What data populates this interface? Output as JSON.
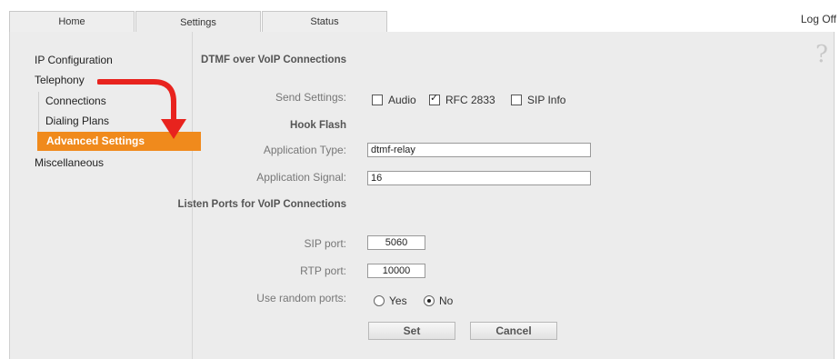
{
  "tabs": [
    {
      "label": "Home"
    },
    {
      "label": "Settings"
    },
    {
      "label": "Status"
    }
  ],
  "header": {
    "logoff": "Log Off",
    "help_icon": "?"
  },
  "sidebar": {
    "items": [
      {
        "label": "IP Configuration"
      },
      {
        "label": "Telephony"
      },
      {
        "label": "Connections"
      },
      {
        "label": "Dialing Plans"
      },
      {
        "label": "Advanced Settings"
      },
      {
        "label": "Miscellaneous"
      }
    ],
    "accent_color": "#f08a1c",
    "arrow_color": "#e8231e"
  },
  "form": {
    "dtmf_heading": "DTMF over VoIP Connections",
    "send_settings_label": "Send Settings:",
    "send_options": [
      {
        "label": "Audio",
        "checked": false
      },
      {
        "label": "RFC 2833",
        "checked": true
      },
      {
        "label": "SIP Info",
        "checked": false
      }
    ],
    "hook_flash_heading": "Hook Flash",
    "application_type_label": "Application Type:",
    "application_type_value": "dtmf-relay",
    "application_signal_label": "Application Signal:",
    "application_signal_value": "16",
    "listen_ports_heading": "Listen Ports for VoIP Connections",
    "sip_port_label": "SIP port:",
    "sip_port_value": "5060",
    "rtp_port_label": "RTP port:",
    "rtp_port_value": "10000",
    "random_ports_label": "Use random ports:",
    "random_options": [
      {
        "label": "Yes",
        "checked": false
      },
      {
        "label": "No",
        "checked": true
      }
    ],
    "set_button": "Set",
    "cancel_button": "Cancel"
  }
}
